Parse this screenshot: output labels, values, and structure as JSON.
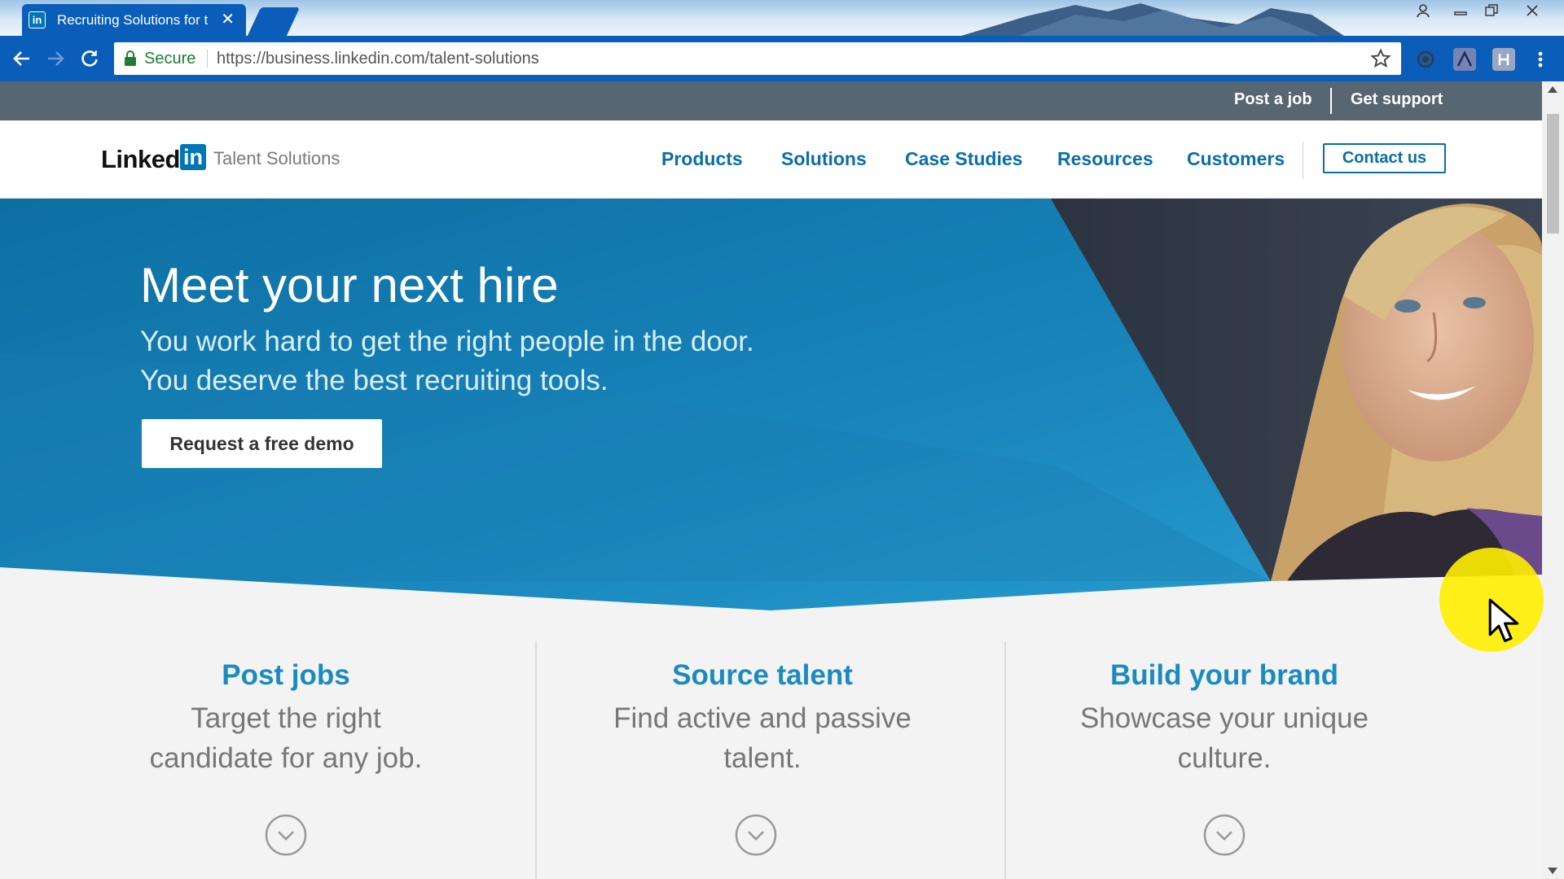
{
  "browser": {
    "tab_title": "Recruiting Solutions for t",
    "tab_favicon": "in",
    "secure_label": "Secure",
    "url": "https://business.linkedin.com/talent-solutions",
    "accent_color": "#0a5db8"
  },
  "utility_bar": {
    "post_job": "Post a job",
    "get_support": "Get support"
  },
  "brand": {
    "wordmark": "Linked",
    "in_badge": "in",
    "subtitle": "Talent Solutions",
    "color": "#0077b5"
  },
  "nav": {
    "items": [
      {
        "label": "Products"
      },
      {
        "label": "Solutions"
      },
      {
        "label": "Case Studies"
      },
      {
        "label": "Resources"
      },
      {
        "label": "Customers"
      }
    ],
    "contact": "Contact us"
  },
  "hero": {
    "title": "Meet your next hire",
    "subtitle_line1": "You work hard to get the right people in the door.",
    "subtitle_line2": "You deserve the best recruiting tools.",
    "cta": "Request a free demo"
  },
  "features": [
    {
      "title": "Post jobs",
      "desc_line1": "Target the right",
      "desc_line2": "candidate for any job.",
      "icon": "chevron-down-circle-icon"
    },
    {
      "title": "Source talent",
      "desc_line1": "Find active and passive",
      "desc_line2": "talent.",
      "icon": "chevron-down-circle-icon"
    },
    {
      "title": "Build your brand",
      "desc_line1": "Showcase your unique",
      "desc_line2": "culture.",
      "icon": "chevron-down-circle-icon"
    }
  ]
}
